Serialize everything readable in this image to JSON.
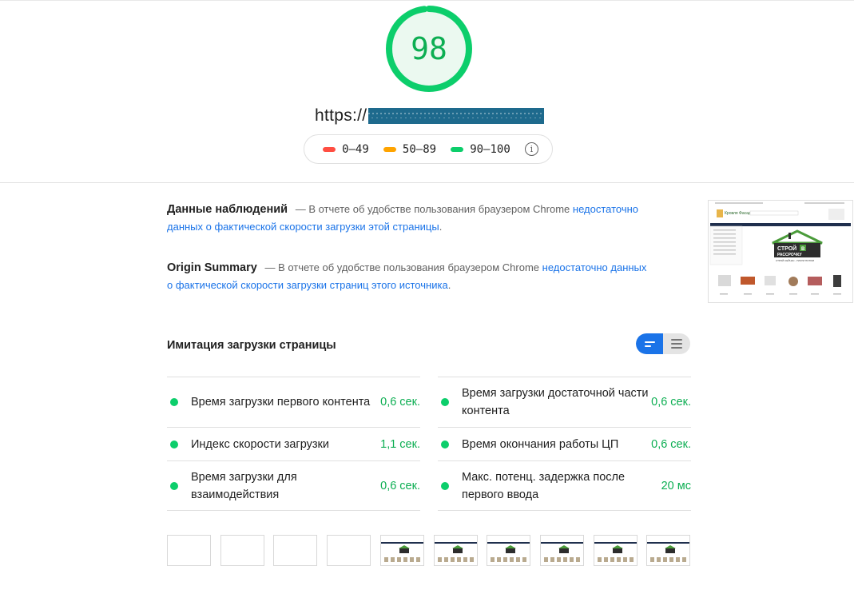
{
  "score": {
    "value": "98",
    "fraction": 0.98,
    "color": "#0cce6b"
  },
  "url": {
    "prefix": "https://"
  },
  "legend": [
    {
      "label": "0–49",
      "color": "#ff4e42"
    },
    {
      "label": "50–89",
      "color": "#ffa400"
    },
    {
      "label": "90–100",
      "color": "#0cce6b"
    }
  ],
  "field_data": {
    "title": "Данные наблюдений",
    "dash": "—",
    "text": "В отчете об удобстве пользования браузером Chrome",
    "link": "недостаточно данных о фактической скорости загрузки этой страницы",
    "end": "."
  },
  "origin_summary": {
    "title": "Origin Summary",
    "dash": "—",
    "text": "В отчете об удобстве пользования браузером Chrome",
    "link": "недостаточно данных о фактической скорости загрузки страниц этого источника",
    "end": "."
  },
  "lab": {
    "title": "Имитация загрузки страницы",
    "metrics_left": [
      {
        "label": "Время загрузки первого контента",
        "value": "0,6 сек."
      },
      {
        "label": "Индекс скорости загрузки",
        "value": "1,1 сек."
      },
      {
        "label": "Время загрузки для взаимодействия",
        "value": "0,6 сек."
      }
    ],
    "metrics_right": [
      {
        "label": "Время загрузки достаточной части контента",
        "value": "0,6 сек."
      },
      {
        "label": "Время окончания работы ЦП",
        "value": "0,6 сек."
      },
      {
        "label": "Макс. потенц. задержка после первого ввода",
        "value": "20 мс"
      }
    ]
  },
  "thumbnail": {
    "logo_line1": "СТРОЙ",
    "logo_badge": "В",
    "logo_line2": "РАССРОЧКУ",
    "tagline": "СТРОЙ СЕЙЧАС - ПЛАТИ ПОТОМ",
    "brand": "Кровля Фасад"
  },
  "filmstrip": {
    "blank_frames": 4,
    "loaded_frames": 6
  }
}
